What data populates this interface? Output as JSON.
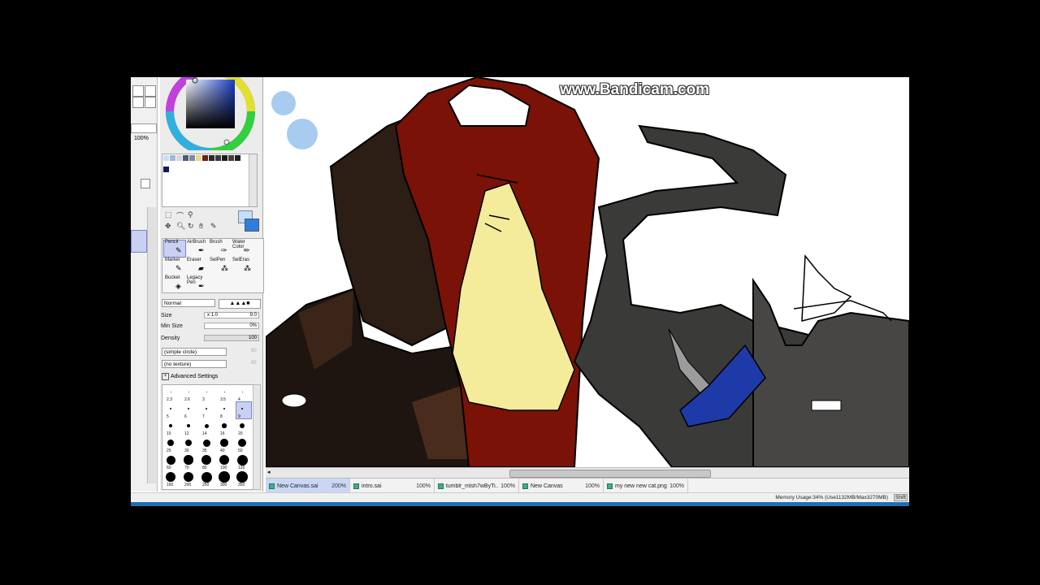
{
  "app": {
    "watermark": "www.Bandicam.com",
    "zoom_left": "100%",
    "blend_mode": "Normal",
    "size_label": "Size",
    "size_multiplier": "x 1.0",
    "size_value": "9.0",
    "min_size_label": "Min Size",
    "min_size_value": "0%",
    "density_label": "Density",
    "density_value": "100",
    "shape_dropdown": "(simple circle)",
    "shape_value": "50",
    "texture_dropdown": "(no texture)",
    "texture_value": "95",
    "advanced_settings": "Advanced Settings",
    "memory_usage": "Memory Usage:34% (Use1132MB/Max3270MB)",
    "shift_key": "Shift",
    "accent_color": "#2f7de0"
  },
  "tools": {
    "pencil": "Pencil",
    "airbrush": "AirBrush",
    "brush": "Brush",
    "water_color": "Water Color",
    "marker": "Marker",
    "eraser": "Eraser",
    "selpen": "SelPen",
    "selers": "SelEras",
    "bucket": "Bucket",
    "legacy_pen": "Legacy Pen"
  },
  "brush_sizes": {
    "row1": [
      "2.3",
      "2.6",
      "3",
      "3.5",
      "4"
    ],
    "row2": [
      "5",
      "6",
      "7",
      "8",
      "9"
    ],
    "row3": [
      "10",
      "12",
      "14",
      "16",
      "20"
    ],
    "row4": [
      "25",
      "30",
      "35",
      "40",
      "50"
    ],
    "row5": [
      "60",
      "70",
      "80",
      "100",
      "120"
    ],
    "row6": [
      "160",
      "200",
      "250",
      "300",
      "350"
    ]
  },
  "tabs": [
    {
      "name": "New Canvas.sai",
      "zoom": "200%"
    },
    {
      "name": "intro.sai",
      "zoom": "100%"
    },
    {
      "name": "tumblr_mlsh7wByTi...",
      "zoom": "100%"
    },
    {
      "name": "New Canvas",
      "zoom": "100%"
    },
    {
      "name": "my new new cat.png",
      "zoom": "100%"
    }
  ]
}
